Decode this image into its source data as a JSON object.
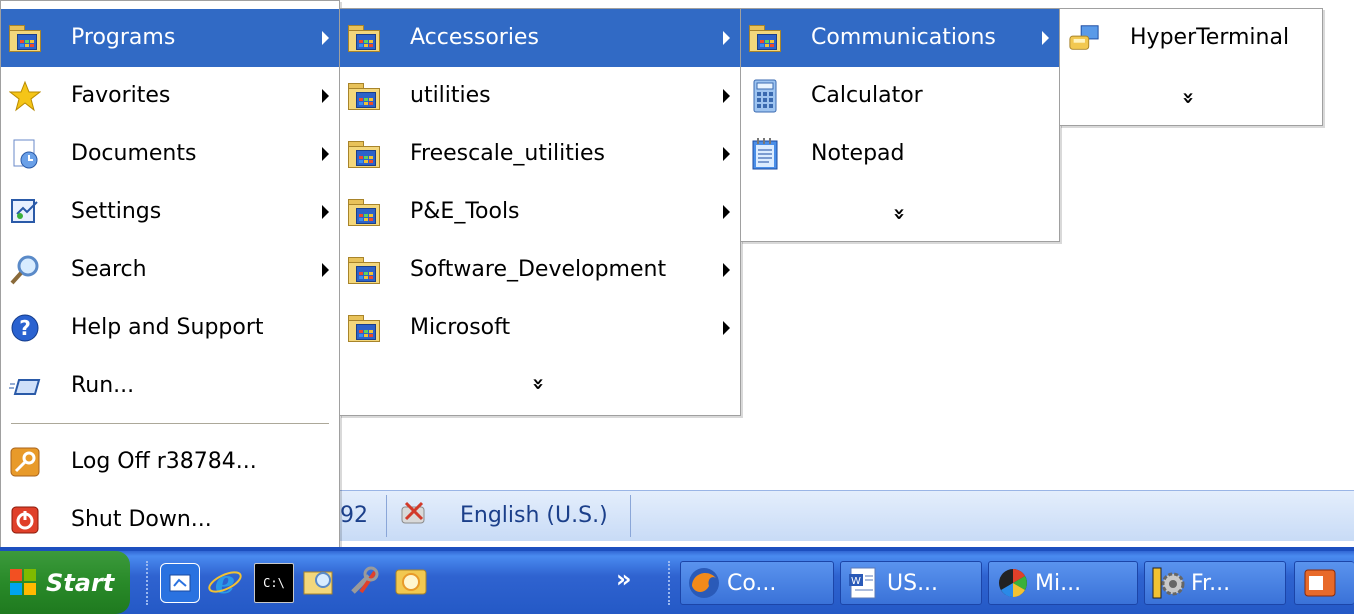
{
  "start_menu": {
    "items": [
      {
        "label": "Programs",
        "icon": "programs-icon"
      },
      {
        "label": "Favorites",
        "icon": "star-icon"
      },
      {
        "label": "Documents",
        "icon": "documents-icon"
      },
      {
        "label": "Settings",
        "icon": "settings-icon"
      },
      {
        "label": "Search",
        "icon": "search-icon"
      },
      {
        "label": "Help and Support",
        "icon": "help-icon"
      },
      {
        "label": "Run...",
        "icon": "run-icon"
      },
      {
        "label": "Log Off r38784...",
        "icon": "key-icon"
      },
      {
        "label": "Shut Down...",
        "icon": "power-icon"
      }
    ]
  },
  "programs_menu": {
    "items": [
      {
        "label": "Accessories"
      },
      {
        "label": "utilities"
      },
      {
        "label": "Freescale_utilities"
      },
      {
        "label": "P&E_Tools"
      },
      {
        "label": "Software_Development"
      },
      {
        "label": "Microsoft"
      }
    ],
    "more": "»"
  },
  "accessories_menu": {
    "items": [
      {
        "label": "Communications"
      },
      {
        "label": "Calculator"
      },
      {
        "label": "Notepad"
      }
    ],
    "more": "»"
  },
  "communications_menu": {
    "items": [
      {
        "label": "HyperTerminal"
      }
    ],
    "more": "»"
  },
  "language_bar": {
    "partial_text": "92",
    "language": "English (U.S.)"
  },
  "taskbar": {
    "start_label": "Start",
    "overflow": "»",
    "buttons": [
      {
        "label": "Co...",
        "icon": "firefox-icon"
      },
      {
        "label": "US...",
        "icon": "word-document-icon"
      },
      {
        "label": "Mi...",
        "icon": "media-icon"
      },
      {
        "label": "Fr...",
        "icon": "freescale-gear-icon"
      }
    ]
  },
  "colors": {
    "selection": "#316ac5",
    "taskbar": "#2459c6",
    "start_button": "#298a29"
  }
}
